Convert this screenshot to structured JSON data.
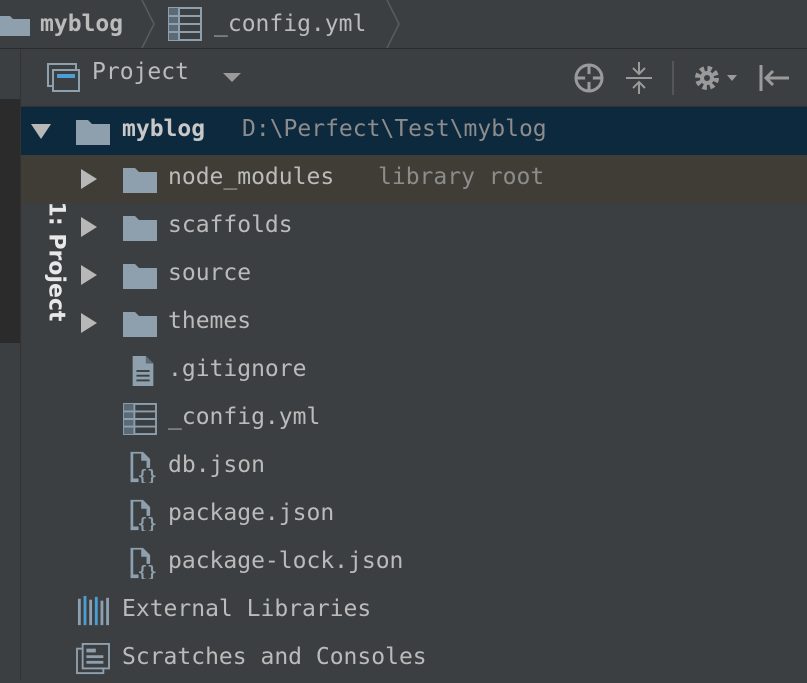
{
  "breadcrumb": {
    "project": "myblog",
    "file": "_config.yml"
  },
  "side_tab": {
    "label": "1: Project"
  },
  "panel": {
    "title": "Project",
    "toolbar_icons": [
      "locate-icon",
      "collapse-all-icon",
      "gear-icon",
      "hide-panel-icon"
    ]
  },
  "tree": {
    "root": {
      "name": "myblog",
      "path": "D:\\Perfect\\Test\\myblog"
    },
    "folders": [
      {
        "name": "node_modules",
        "hint": "library root"
      },
      {
        "name": "scaffolds",
        "hint": ""
      },
      {
        "name": "source",
        "hint": ""
      },
      {
        "name": "themes",
        "hint": ""
      }
    ],
    "files": [
      {
        "name": ".gitignore",
        "icon": "text-file-icon"
      },
      {
        "name": "_config.yml",
        "icon": "yml-file-icon"
      },
      {
        "name": "db.json",
        "icon": "json-file-icon"
      },
      {
        "name": "package.json",
        "icon": "json-file-icon"
      },
      {
        "name": "package-lock.json",
        "icon": "json-file-icon"
      }
    ],
    "external_libraries": "External Libraries",
    "scratches": "Scratches and Consoles"
  },
  "colors": {
    "background": "#3c3f41",
    "selected_row": "#0d293e",
    "library_row": "#3f3d35",
    "folder": "#8e9fad",
    "text": "#bbbbbb",
    "hint_text": "#8c8c8c"
  }
}
